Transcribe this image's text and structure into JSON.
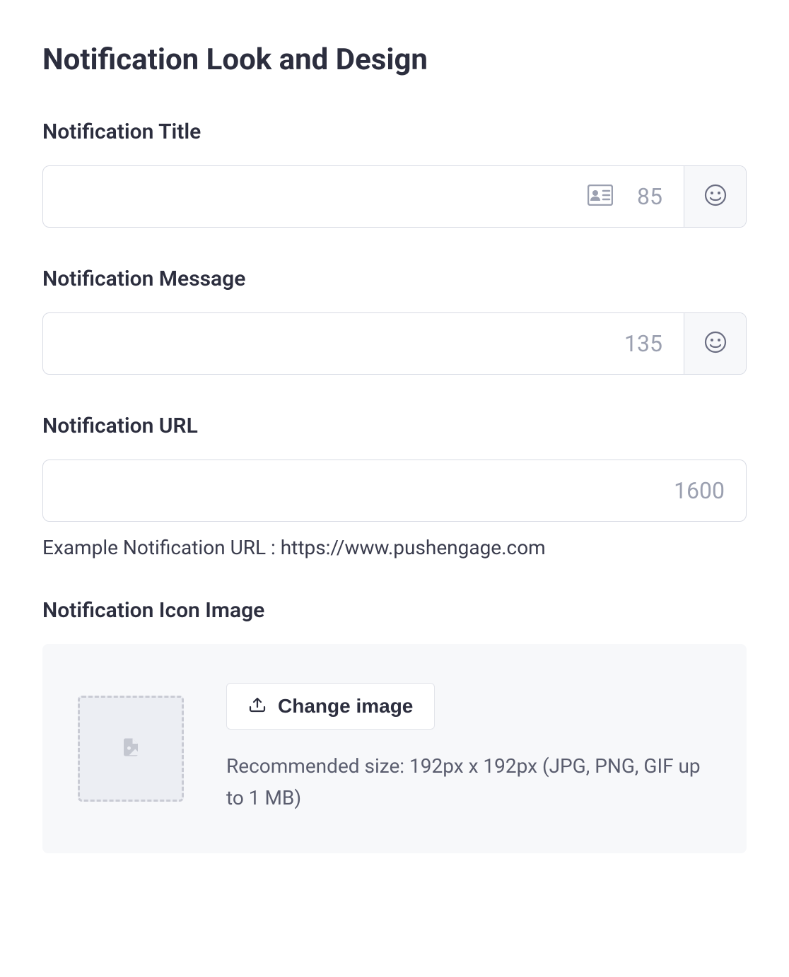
{
  "page": {
    "heading": "Notification Look and Design"
  },
  "title_field": {
    "label": "Notification Title",
    "value": "",
    "counter": "85"
  },
  "message_field": {
    "label": "Notification Message",
    "value": "",
    "counter": "135"
  },
  "url_field": {
    "label": "Notification URL",
    "value": "",
    "counter": "1600",
    "helper": "Example Notification URL : https://www.pushengage.com"
  },
  "icon_image": {
    "label": "Notification Icon Image",
    "button": "Change image",
    "recommendation": "Recommended size: 192px x 192px (JPG, PNG, GIF up to 1 MB)"
  }
}
